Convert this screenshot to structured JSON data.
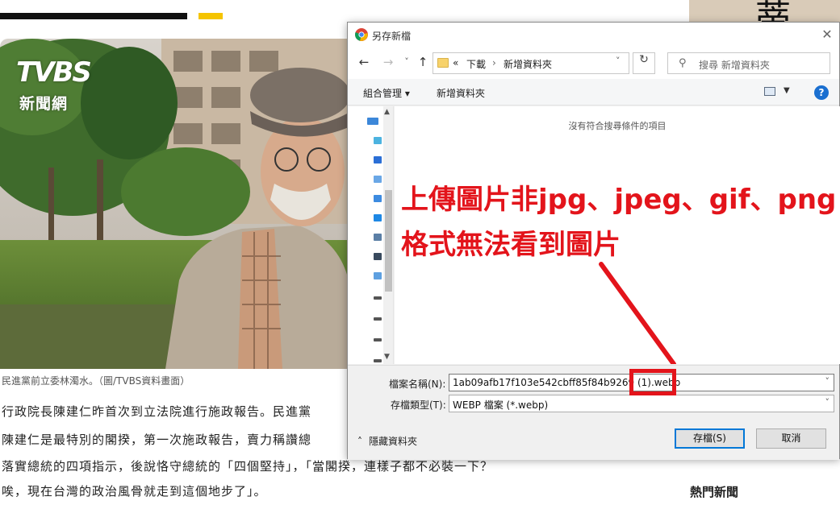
{
  "article": {
    "caption": "民進黨前立委林濁水。（圖/TVBS資料畫面）",
    "lines": [
      "行政院長陳建仁昨首次到立法院進行施政報告。民進黨",
      "陳建仁是最特別的閣揆，第一次施政報告，賣力稱讚總",
      "落實總統的四項指示，後說恪守總統的「四個堅持」，「當閣揆，連樣子都不必裝一下？",
      "唉，現在台灣的政治風骨就走到這個地步了」。"
    ],
    "hot_news_label": "熱門新聞",
    "logo_text": "TVBS",
    "logo_sub": "新聞網"
  },
  "dialog": {
    "title": "另存新檔",
    "close_glyph": "✕",
    "nav": {
      "back": "←",
      "forward": "→",
      "dropdown": "˅",
      "up": "↑",
      "breadcrumb_prefix": "«",
      "crumb1": "下載",
      "separator": "›",
      "crumb2": "新增資料夾",
      "refresh": "↻"
    },
    "search_placeholder": "搜尋 新增資料夾",
    "toolbar": {
      "organize": "組合管理 ▾",
      "new_folder": "新增資料夾",
      "help": "?"
    },
    "empty_message": "沒有符合搜尋條件的項目",
    "annotation": {
      "line1": "上傳圖片非jpg、jpeg、gif、png",
      "line2": "格式無法看到圖片",
      "color": "#e3141b"
    },
    "filename_label": "檔案名稱(N):",
    "filename_value": "1ab09afb17f103e542cbff85f84b9269 (1).webp",
    "filetype_label": "存檔類型(T):",
    "filetype_value": "WEBP 檔案 (*.webp)",
    "hide_folders": "隱藏資料夾",
    "save_button": "存檔(S)",
    "cancel_button": "取消"
  }
}
